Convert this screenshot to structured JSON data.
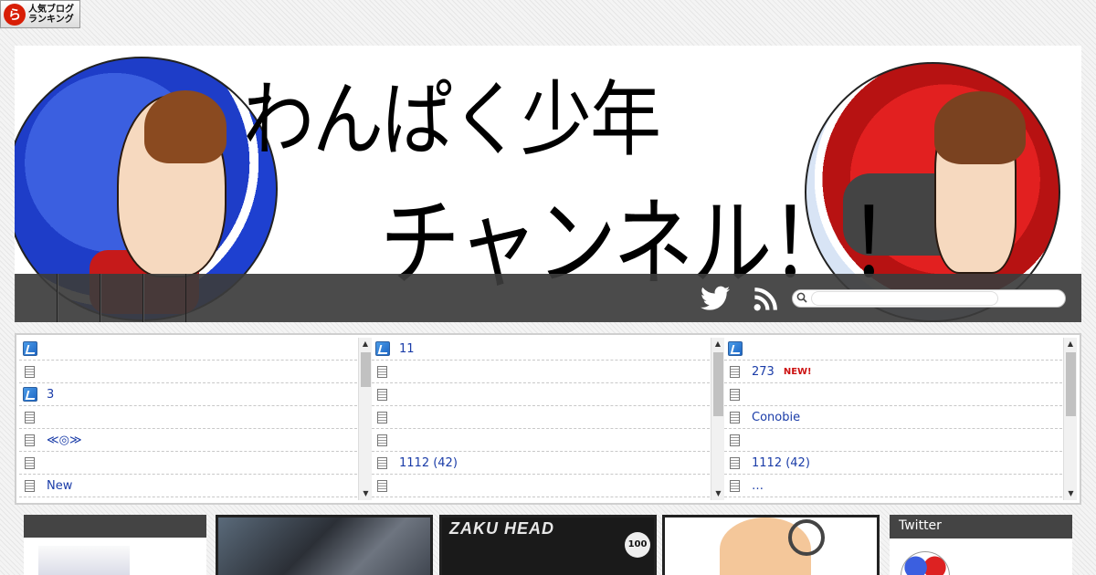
{
  "rank_badge": {
    "line1": "人気ブログ",
    "line2": "ランキング",
    "logo": "ranking-logo-icon"
  },
  "header": {
    "title_line1": "わんぱく少年",
    "title_line2": "チャンネル！！",
    "nav_items": [
      "",
      "",
      "",
      ""
    ],
    "icons": [
      "twitter-icon",
      "rss-icon"
    ],
    "search": {
      "placeholder": "",
      "button_label": ""
    }
  },
  "rss_columns": [
    {
      "items": [
        {
          "icon": "feed",
          "text": ""
        },
        {
          "icon": "doc",
          "text": ""
        },
        {
          "icon": "feed",
          "text": "3"
        },
        {
          "icon": "doc",
          "text": ""
        },
        {
          "icon": "doc",
          "text": "≪◎≫"
        },
        {
          "icon": "doc",
          "text": ""
        },
        {
          "icon": "doc",
          "text": "New"
        }
      ]
    },
    {
      "items": [
        {
          "icon": "feed",
          "text": "11"
        },
        {
          "icon": "doc",
          "text": ""
        },
        {
          "icon": "doc",
          "text": ""
        },
        {
          "icon": "doc",
          "text": ""
        },
        {
          "icon": "doc",
          "text": ""
        },
        {
          "icon": "doc",
          "text": "1112 (42)"
        },
        {
          "icon": "doc",
          "text": ""
        }
      ]
    },
    {
      "items": [
        {
          "icon": "feed",
          "text": ""
        },
        {
          "icon": "doc",
          "text": "273",
          "badge": "NEW!"
        },
        {
          "icon": "doc",
          "text": ""
        },
        {
          "icon": "doc",
          "text": " Conobie"
        },
        {
          "icon": "doc",
          "text": ""
        },
        {
          "icon": "doc",
          "text": "1112 (42)"
        },
        {
          "icon": "doc",
          "text": "…"
        }
      ]
    }
  ],
  "thumbnails": {
    "zaku_title": "ZAKU HEAD",
    "zaku_badge": "100"
  },
  "twitter": {
    "title": "Twitter"
  },
  "colors": {
    "link": "#1a3ca8",
    "new_badge": "#cc1111",
    "nav_bg": "#3c3c3c"
  }
}
